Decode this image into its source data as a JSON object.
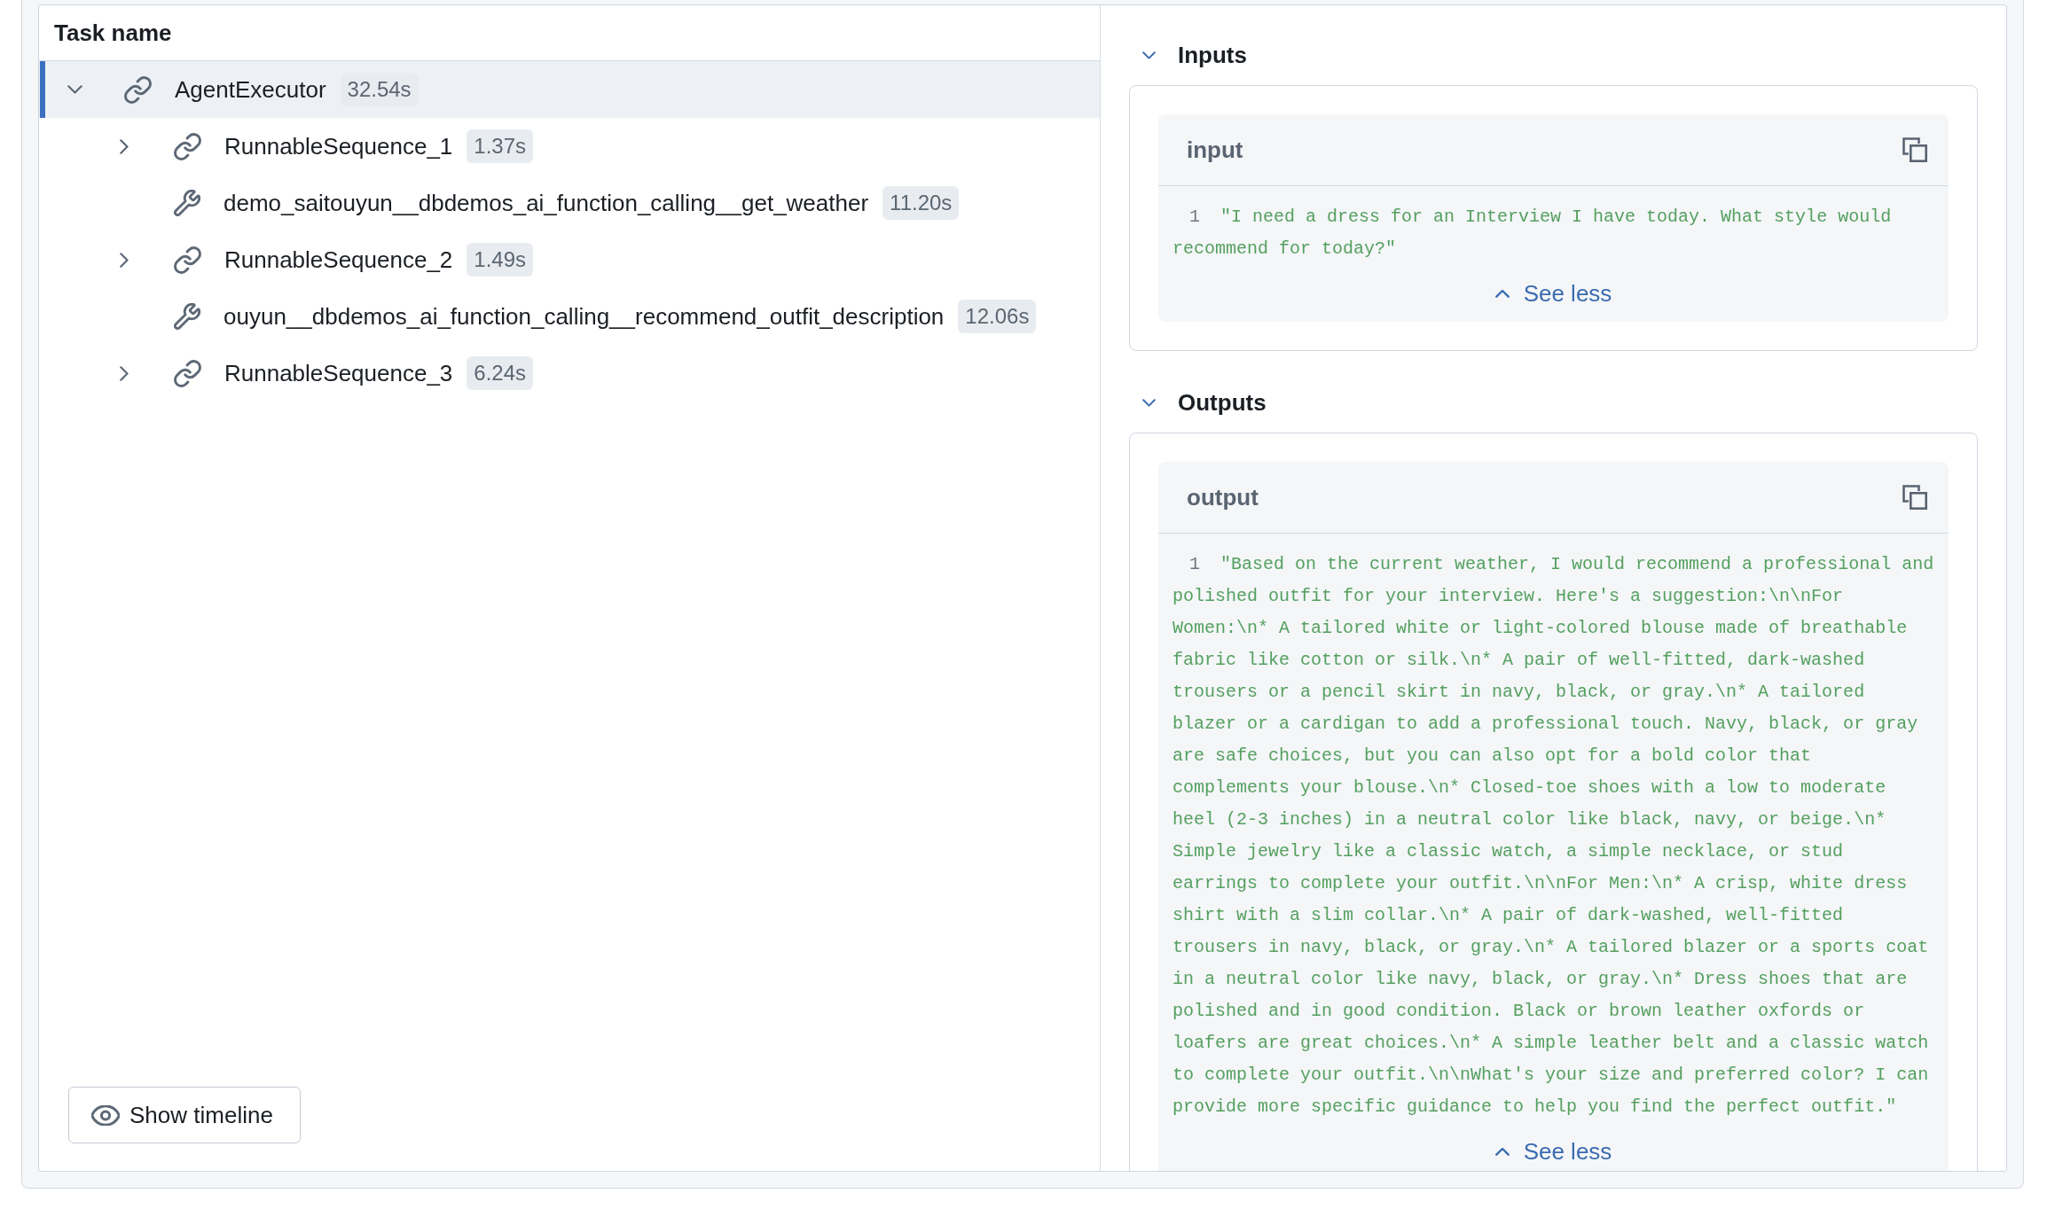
{
  "tree": {
    "header": "Task name",
    "items": [
      {
        "kind": "chain",
        "label": "AgentExecutor",
        "duration": "32.54s",
        "selected": true,
        "expanded": true,
        "children": [
          {
            "kind": "chain",
            "label": "RunnableSequence_1",
            "duration": "1.37s",
            "selected": false,
            "expanded": false
          },
          {
            "kind": "tool",
            "label": "demo_saitouyun__dbdemos_ai_function_calling__get_weather",
            "duration": "11.20s",
            "selected": false
          },
          {
            "kind": "chain",
            "label": "RunnableSequence_2",
            "duration": "1.49s",
            "selected": false,
            "expanded": false
          },
          {
            "kind": "tool",
            "label": "ouyun__dbdemos_ai_function_calling__recommend_outfit_description",
            "duration": "12.06s",
            "selected": false
          },
          {
            "kind": "chain",
            "label": "RunnableSequence_3",
            "duration": "6.24s",
            "selected": false,
            "expanded": false
          }
        ]
      }
    ]
  },
  "timeline_button": {
    "label": "Show timeline"
  },
  "sections": [
    {
      "title": "Inputs",
      "expanded": true,
      "fields": [
        {
          "name": "input",
          "line_number": "1",
          "value": "\"I need a dress for an Interview I have today. What style would recommend for today?\"",
          "toggle": "See less"
        }
      ]
    },
    {
      "title": "Outputs",
      "expanded": true,
      "fields": [
        {
          "name": "output",
          "line_number": "1",
          "value": "\"Based on the current weather, I would recommend a professional and polished outfit for your interview. Here's a suggestion:\\n\\nFor Women:\\n* A tailored white or light-colored blouse made of breathable fabric like cotton or silk.\\n* A pair of well-fitted, dark-washed trousers or a pencil skirt in navy, black, or gray.\\n* A tailored blazer or a cardigan to add a professional touch. Navy, black, or gray are safe choices, but you can also opt for a bold color that complements your blouse.\\n* Closed-toe shoes with a low to moderate heel (2-3 inches) in a neutral color like black, navy, or beige.\\n* Simple jewelry like a classic watch, a simple necklace, or stud earrings to complete your outfit.\\n\\nFor Men:\\n* A crisp, white dress shirt with a slim collar.\\n* A pair of dark-washed, well-fitted trousers in navy, black, or gray.\\n* A tailored blazer or a sports coat in a neutral color like navy, black, or gray.\\n* Dress shoes that are polished and in good condition. Black or brown leather oxfords or loafers are great choices.\\n* A simple leather belt and a classic watch to complete your outfit.\\n\\nWhat's your size and preferred color? I can provide more specific guidance to help you find the perfect outfit.\"",
          "toggle": "See less"
        }
      ]
    }
  ]
}
